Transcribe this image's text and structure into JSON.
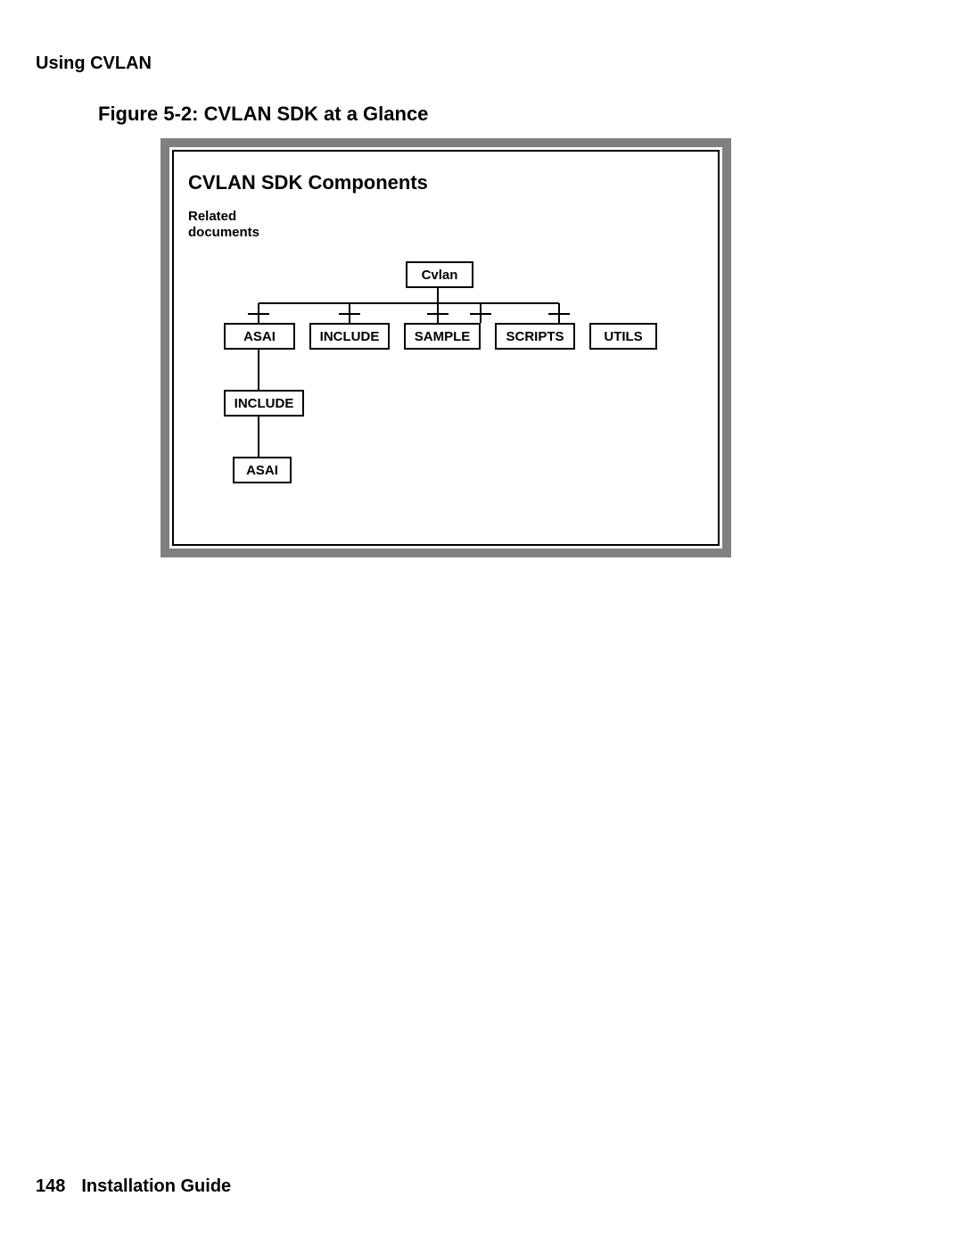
{
  "header": {
    "running": "Using CVLAN"
  },
  "figure": {
    "caption": "Figure 5-2: CVLAN SDK at a Glance",
    "title": "CVLAN SDK Components",
    "subtitle_line1": "Related",
    "subtitle_line2": "documents",
    "nodes": {
      "root": "Cvlan",
      "children": [
        "ASAI",
        "INCLUDE",
        "SAMPLE",
        "SCRIPTS",
        "UTILS"
      ],
      "gchild": "INCLUDE",
      "ggchild": "ASAI"
    }
  },
  "footer": {
    "page_number": "148",
    "title": "Installation Guide"
  }
}
